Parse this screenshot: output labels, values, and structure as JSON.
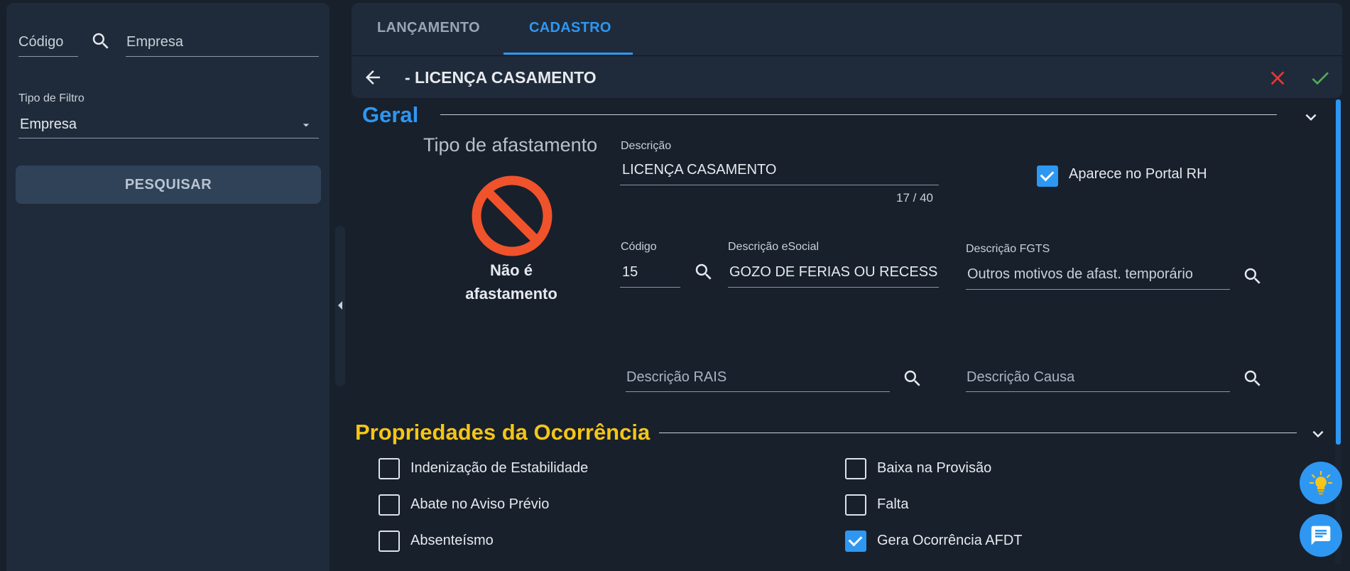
{
  "filters": {
    "codigo_placeholder": "Código",
    "empresa_placeholder": "Empresa",
    "tipo_filtro_label": "Tipo de Filtro",
    "tipo_filtro_value": "Empresa",
    "search_button": "PESQUISAR"
  },
  "tabs": [
    {
      "label": "LANÇAMENTO"
    },
    {
      "label": "CADASTRO"
    }
  ],
  "header": {
    "title": "- LICENÇA CASAMENTO"
  },
  "geral": {
    "section_title": "Geral",
    "tipo_afastamento_label": "Tipo de afastamento",
    "tipo_afastamento_line1": "Não é",
    "tipo_afastamento_line2": "afastamento",
    "descricao_label": "Descrição",
    "descricao_value": "LICENÇA CASAMENTO",
    "descricao_counter": "17 / 40",
    "portal_rh_label": "Aparece no Portal RH",
    "portal_rh_checked": true,
    "codigo_label": "Código",
    "codigo_value": "15",
    "esocial_label": "Descrição eSocial",
    "esocial_value": "GOZO DE FERIAS OU RECESSO - AFASTAMENTO",
    "fgts_label": "Descrição FGTS",
    "fgts_value": "Outros motivos de afast. temporário",
    "rais_placeholder": "Descrição RAIS",
    "causa_placeholder": "Descrição Causa"
  },
  "propriedades": {
    "section_title": "Propriedades da Ocorrência",
    "items_left": [
      {
        "label": "Indenização de Estabilidade",
        "checked": false
      },
      {
        "label": "Abate no Aviso Prévio",
        "checked": false
      },
      {
        "label": "Absenteísmo",
        "checked": false
      }
    ],
    "items_right": [
      {
        "label": "Baixa na Provisão",
        "checked": false
      },
      {
        "label": "Falta",
        "checked": false
      },
      {
        "label": "Gera Ocorrência AFDT",
        "checked": true
      }
    ]
  },
  "colors": {
    "accent": "#2e97f2",
    "section_yellow": "#f5c518",
    "cancel_red": "#e53935",
    "confirm_green": "#4caf50",
    "forbidden_orange": "#f0522c"
  }
}
